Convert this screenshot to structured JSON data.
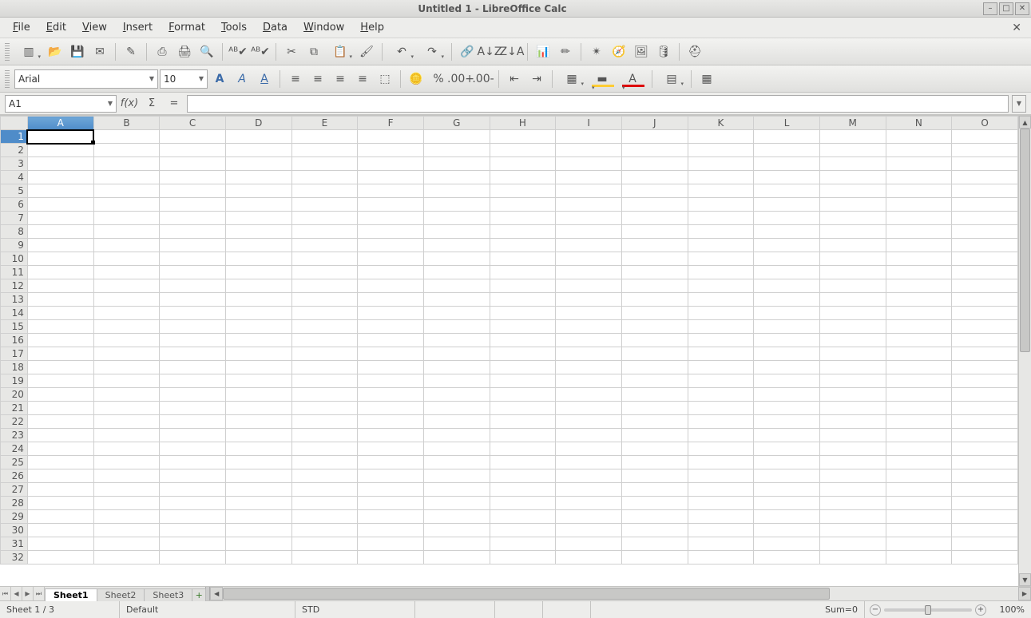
{
  "window": {
    "title": "Untitled 1 - LibreOffice Calc"
  },
  "menu": {
    "items": [
      "File",
      "Edit",
      "View",
      "Insert",
      "Format",
      "Tools",
      "Data",
      "Window",
      "Help"
    ]
  },
  "toolbar1": {
    "buttons": [
      {
        "name": "new-doc",
        "glyph": "▥",
        "drop": true
      },
      {
        "name": "open",
        "glyph": "📂"
      },
      {
        "name": "save",
        "glyph": "💾"
      },
      {
        "name": "email",
        "glyph": "✉"
      },
      "sep",
      {
        "name": "edit-mode",
        "glyph": "✎"
      },
      "sep",
      {
        "name": "export-pdf",
        "glyph": "⎙"
      },
      {
        "name": "print",
        "glyph": "🖨"
      },
      {
        "name": "print-preview",
        "glyph": "🔍"
      },
      "sep",
      {
        "name": "spellcheck",
        "glyph": "ᴬᴮ✔"
      },
      {
        "name": "auto-spellcheck",
        "glyph": "ᴬᴮ✔"
      },
      "sep",
      {
        "name": "cut",
        "glyph": "✂"
      },
      {
        "name": "copy",
        "glyph": "⧉"
      },
      {
        "name": "paste",
        "glyph": "📋",
        "drop": true
      },
      {
        "name": "format-paintbrush",
        "glyph": "🖌"
      },
      "sep",
      {
        "name": "undo",
        "glyph": "↶",
        "drop": true
      },
      {
        "name": "redo",
        "glyph": "↷",
        "drop": true
      },
      "sep",
      {
        "name": "hyperlink",
        "glyph": "🔗"
      },
      {
        "name": "sort-asc",
        "glyph": "A↓Z"
      },
      {
        "name": "sort-desc",
        "glyph": "Z↓A"
      },
      "sep",
      {
        "name": "chart",
        "glyph": "📊"
      },
      {
        "name": "show-draw",
        "glyph": "✏"
      },
      "sep",
      {
        "name": "find",
        "glyph": "✴"
      },
      {
        "name": "navigator",
        "glyph": "🧭"
      },
      {
        "name": "gallery",
        "glyph": "🖼"
      },
      {
        "name": "data-sources",
        "glyph": "🛢"
      },
      "sep",
      {
        "name": "help",
        "glyph": "⛑"
      }
    ]
  },
  "toolbar2": {
    "font_name": "Arial",
    "font_size": "10",
    "buttons": [
      {
        "name": "bold",
        "glyph": "A",
        "style": "bold",
        "color": "#3a6aa8"
      },
      {
        "name": "italic",
        "glyph": "A",
        "style": "italic",
        "color": "#3a6aa8"
      },
      {
        "name": "underline",
        "glyph": "A",
        "style": "underline",
        "color": "#3a6aa8"
      },
      "sep",
      {
        "name": "align-left",
        "glyph": "≡"
      },
      {
        "name": "align-center",
        "glyph": "≡"
      },
      {
        "name": "align-right",
        "glyph": "≡"
      },
      {
        "name": "align-justify",
        "glyph": "≡"
      },
      {
        "name": "merge-cells",
        "glyph": "⬚"
      },
      "sep",
      {
        "name": "currency",
        "glyph": "🪙"
      },
      {
        "name": "percent",
        "glyph": "%"
      },
      {
        "name": "add-decimal",
        "glyph": ".00+"
      },
      {
        "name": "remove-decimal",
        "glyph": ".00-"
      },
      "sep",
      {
        "name": "decrease-indent",
        "glyph": "⇤"
      },
      {
        "name": "increase-indent",
        "glyph": "⇥"
      },
      "sep",
      {
        "name": "borders",
        "glyph": "▦",
        "drop": true
      },
      {
        "name": "bg-color",
        "glyph": "▬",
        "drop": true
      },
      {
        "name": "font-color",
        "glyph": "A",
        "drop": true
      },
      "sep",
      {
        "name": "lines",
        "glyph": "▤",
        "drop": true
      },
      "sep",
      {
        "name": "grid",
        "glyph": "▦"
      }
    ]
  },
  "formula_bar": {
    "name_box": "A1",
    "fx_label": "f(x)",
    "sum_label": "Σ",
    "eq_label": "=",
    "input": ""
  },
  "grid": {
    "columns": [
      "A",
      "B",
      "C",
      "D",
      "E",
      "F",
      "G",
      "H",
      "I",
      "J",
      "K",
      "L",
      "M",
      "N",
      "O"
    ],
    "row_count": 32,
    "selected_cell": {
      "col": "A",
      "row": 1
    }
  },
  "tabs": {
    "sheets": [
      "Sheet1",
      "Sheet2",
      "Sheet3"
    ],
    "active": 0,
    "add_label": "+"
  },
  "status": {
    "sheet_pos": "Sheet 1 / 3",
    "page_style": "Default",
    "insert_mode": "STD",
    "sum": "Sum=0",
    "zoom": "100%"
  }
}
